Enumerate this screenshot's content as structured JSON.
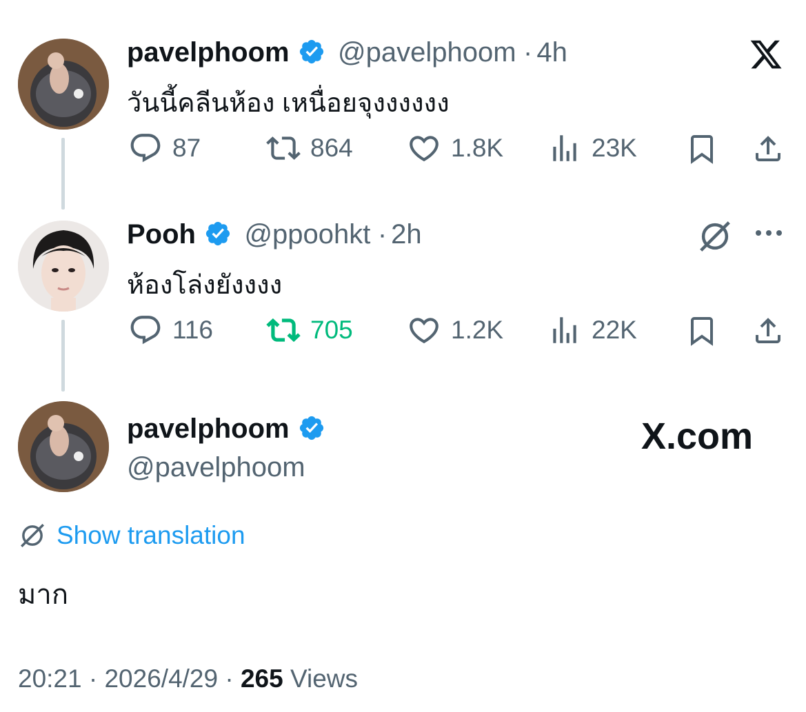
{
  "tweet1": {
    "name": "pavelphoom",
    "handle": "@pavelphoom",
    "sep": "·",
    "time": "4h",
    "text": "วันนี้คลีนห้อง เหนื่อยจุงงงงงง",
    "replies": "87",
    "retweets": "864",
    "likes": "1.8K",
    "views": "23K"
  },
  "tweet2": {
    "name": "Pooh",
    "handle": "@ppoohkt",
    "sep": "·",
    "time": "2h",
    "text": "ห้องโล่งยังงงง",
    "replies": "116",
    "retweets": "705",
    "likes": "1.2K",
    "views": "22K"
  },
  "main": {
    "name": "pavelphoom",
    "handle": "@pavelphoom",
    "brand": "X.com",
    "translate": "Show translation",
    "text": "มาก",
    "time": "20:21",
    "sep": " · ",
    "date": "2026/4/29",
    "views_count": "265",
    "views_label": " Views"
  },
  "colors": {
    "accent": "#1d9bf0",
    "retweeted": "#00ba7c",
    "muted": "#536471",
    "text": "#0f1419"
  }
}
